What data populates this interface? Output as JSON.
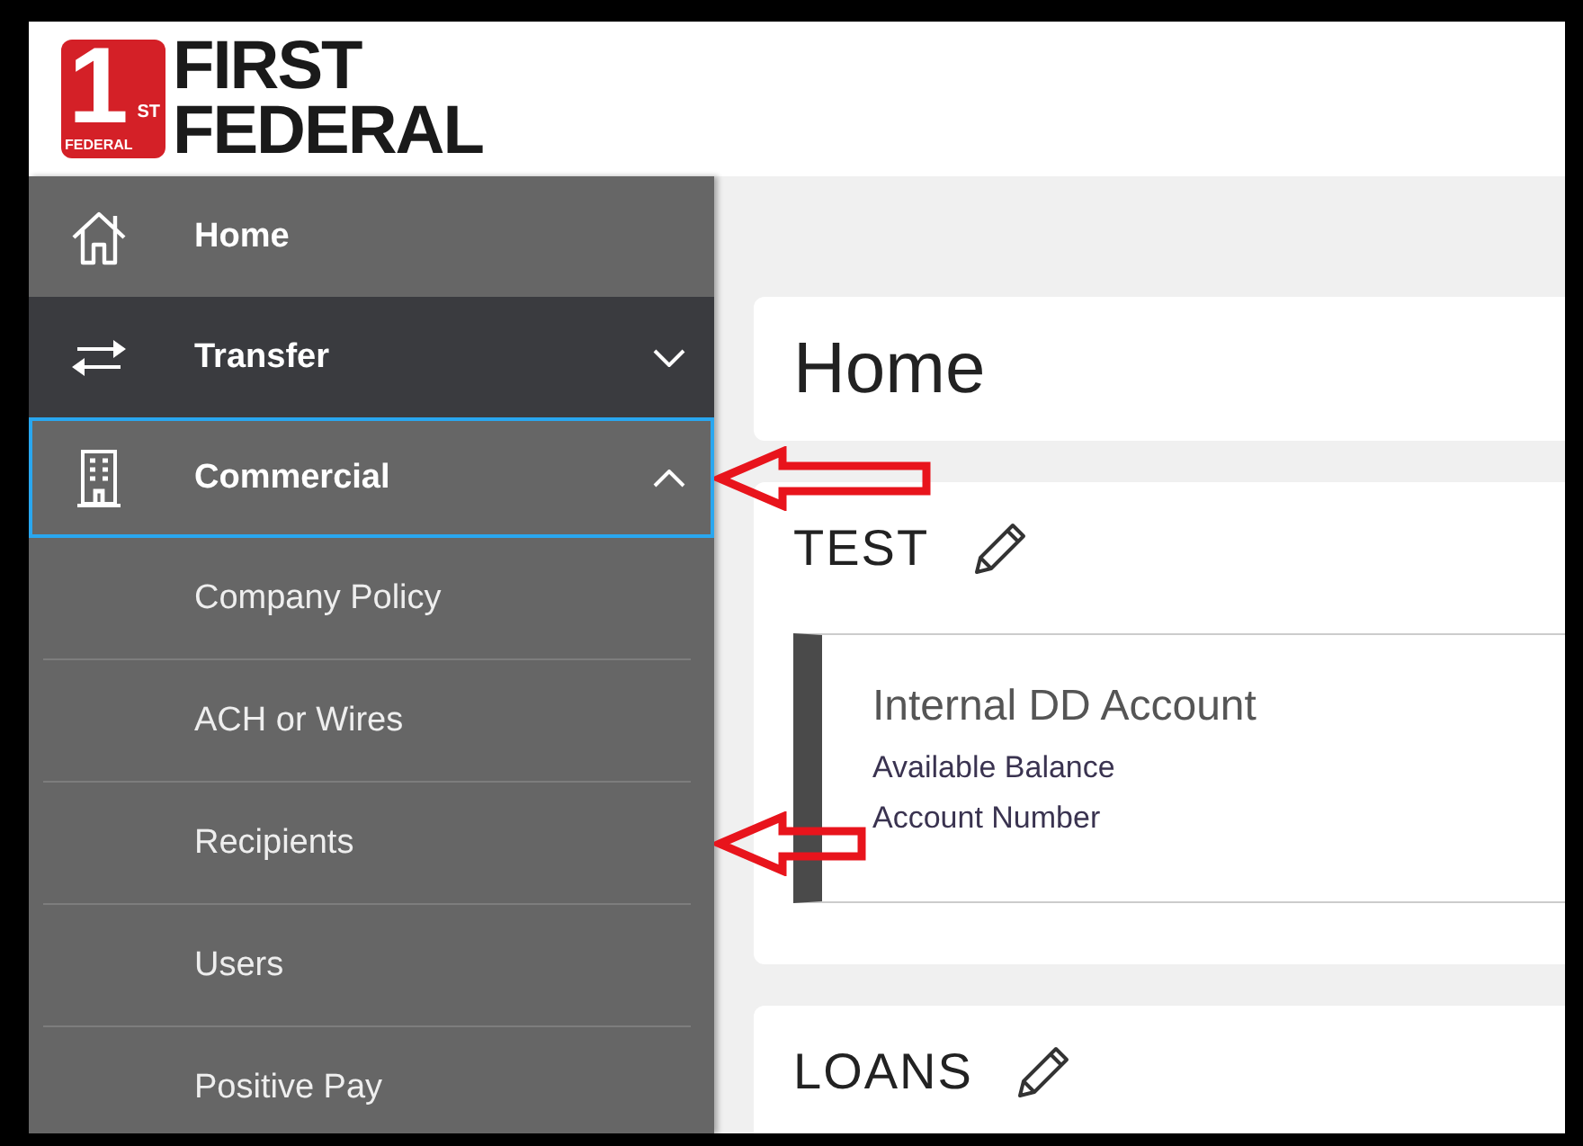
{
  "logo": {
    "mark_digit": "1",
    "mark_suffix": "ST",
    "mark_text": "FEDERAL",
    "line1": "FIRST",
    "line2": "FEDERAL"
  },
  "sidebar": {
    "items": [
      {
        "label": "Home",
        "kind": "link",
        "highlighted": false,
        "focused": false,
        "annotated": false
      },
      {
        "label": "Transfer",
        "kind": "group",
        "highlighted": true,
        "focused": false,
        "expanded": false,
        "annotated": false
      },
      {
        "label": "Commercial",
        "kind": "group",
        "highlighted": false,
        "focused": true,
        "expanded": true,
        "annotated": true,
        "children": [
          {
            "label": "Company Policy",
            "annotated": false
          },
          {
            "label": "ACH or Wires",
            "annotated": false
          },
          {
            "label": "Recipients",
            "annotated": true
          },
          {
            "label": "Users",
            "annotated": false
          },
          {
            "label": "Positive Pay",
            "annotated": false
          }
        ]
      }
    ]
  },
  "page": {
    "title": "Home"
  },
  "sections": [
    {
      "title": "TEST",
      "accounts": [
        {
          "name": "Internal DD Account",
          "lines": [
            "Available Balance",
            "Account Number"
          ]
        }
      ]
    },
    {
      "title": "LOANS"
    }
  ]
}
